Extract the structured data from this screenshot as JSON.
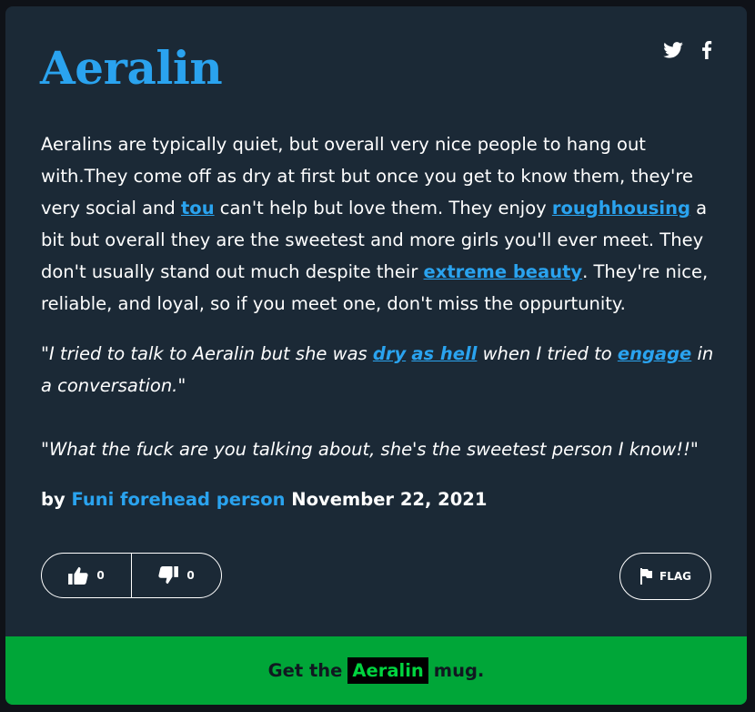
{
  "entry": {
    "word": "Aeralin",
    "meaning": {
      "t1": "Aeralins are typically quiet, but overall very nice people to hang out with.They come off as dry at first but once you get to know them, they're very social and ",
      "l1": "tou",
      "t2": " can't help but love them. They enjoy ",
      "l2": "roughhousing",
      "t3": " a bit but overall they are the sweetest and more girls you'll ever meet. They don't usually stand out much despite their ",
      "l3": "extreme beauty",
      "t4": ". They're nice, reliable, and loyal, so if you meet one, don't miss the oppurtunity."
    },
    "example": {
      "e1": "\"I tried to talk to Aeralin but she was ",
      "l1": "dry",
      "s1": " ",
      "l2": "as hell",
      "e2": " when I tried to ",
      "l3": "engage",
      "e3": " in a conversation.\"",
      "e4": "\"What the fuck are you talking about, she's the sweetest person I know!!\""
    },
    "contributor": {
      "by": "by",
      "author": "Funi forehead person",
      "date": "November 22, 2021"
    }
  },
  "votes": {
    "up": "0",
    "down": "0"
  },
  "flag_label": "FLAG",
  "mug": {
    "prefix": "Get the",
    "word": "Aeralin",
    "suffix": "mug."
  },
  "colors": {
    "accent": "#2aa3ef",
    "card": "#1b2936",
    "mug_bg": "#00a638",
    "mug_word": "#00d43f"
  },
  "icons": [
    "twitter-icon",
    "facebook-icon",
    "thumbs-up-icon",
    "thumbs-down-icon",
    "flag-icon"
  ]
}
